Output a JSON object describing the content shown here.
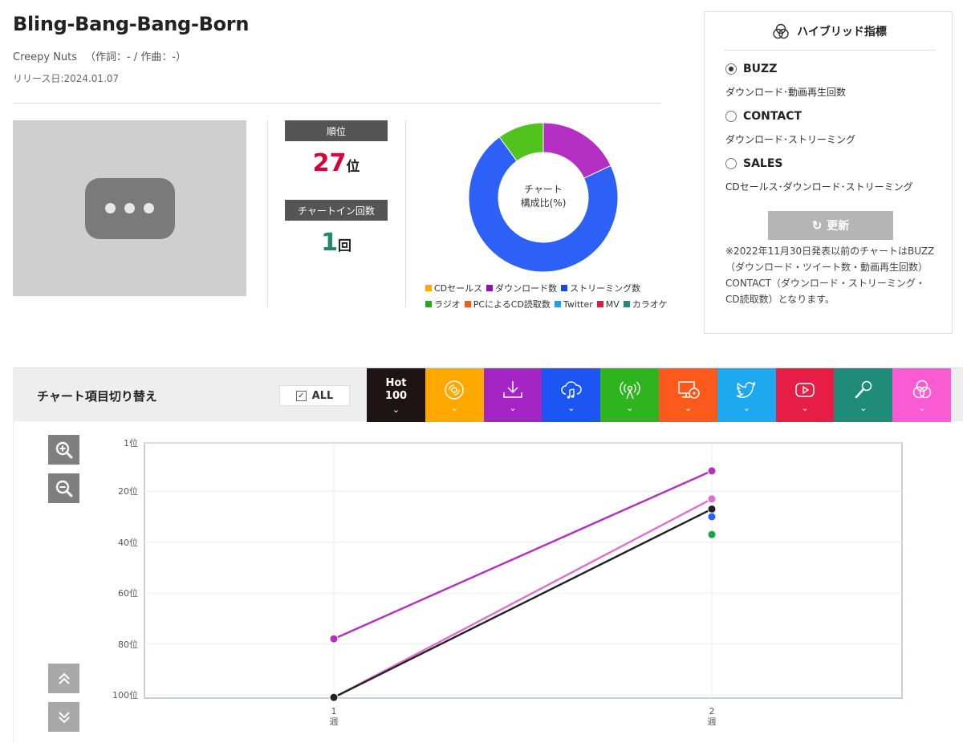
{
  "song": {
    "title": "Bling-Bang-Bang-Born",
    "artist": "Creepy Nuts",
    "credits": "（作詞：- / 作曲：-）",
    "release": "リリース日:2024.01.07"
  },
  "stats": {
    "rank_label": "順位",
    "rank_value": "27",
    "rank_unit": "位",
    "chartin_label": "チャートイン回数",
    "chartin_value": "1",
    "chartin_unit": "回"
  },
  "donut": {
    "center_line1": "チャート",
    "center_line2": "構成比(%)",
    "segments": [
      {
        "name": "ダウンロード数",
        "value": 18,
        "color": "#b52fc3"
      },
      {
        "name": "ストリーミング数",
        "value": 72,
        "color": "#2c60f6"
      },
      {
        "name": "ラジオ",
        "value": 10,
        "color": "#52c21e"
      }
    ],
    "legend": [
      {
        "label": "CDセールス",
        "color": "#ffa800"
      },
      {
        "label": "ダウンロード数",
        "color": "#8e14b0"
      },
      {
        "label": "ストリーミング数",
        "color": "#1448ea"
      },
      {
        "label": "ラジオ",
        "color": "#28a81e"
      },
      {
        "label": "PCによるCD読取数",
        "color": "#fa5a14"
      },
      {
        "label": "Twitter",
        "color": "#1ea0f0"
      },
      {
        "label": "MV",
        "color": "#dc1e3c"
      },
      {
        "label": "カラオケ",
        "color": "#1e8c78"
      }
    ]
  },
  "hybrid": {
    "title": "ハイブリッド指標",
    "options": [
      {
        "label": "BUZZ",
        "desc": "ダウンロード･動画再生回数",
        "selected": true
      },
      {
        "label": "CONTACT",
        "desc": "ダウンロード･ストリーミング",
        "selected": false
      },
      {
        "label": "SALES",
        "desc": "CDセールス･ダウンロード･ストリーミング",
        "selected": false
      }
    ],
    "refresh_label": "更新",
    "note": "※2022年11月30日発表以前のチャートはBUZZ（ダウンロード・ツイート数・動画再生回数）CONTACT（ダウンロード・ストリーミング・CD読取数）となります。"
  },
  "switcher": {
    "title": "チャート項目切り替え",
    "all_label": "ALL",
    "tabs": [
      {
        "name": "hot100",
        "label": "Hot 100",
        "color": "#1f1414",
        "icon": "hot100-text"
      },
      {
        "name": "cd-sales",
        "color": "#ffa800",
        "icon": "disc-icon"
      },
      {
        "name": "download",
        "color": "#a424c4",
        "icon": "download-icon"
      },
      {
        "name": "streaming",
        "color": "#1b55f4",
        "icon": "cloud-music-icon"
      },
      {
        "name": "radio",
        "color": "#2db41e",
        "icon": "radio-icon"
      },
      {
        "name": "pc-cd-read",
        "color": "#fb5a1c",
        "icon": "pc-disc-icon"
      },
      {
        "name": "twitter",
        "color": "#1ea8f0",
        "icon": "twitter-icon"
      },
      {
        "name": "mv",
        "color": "#e61e46",
        "icon": "youtube-icon"
      },
      {
        "name": "karaoke",
        "color": "#1e8c78",
        "icon": "microphone-icon"
      },
      {
        "name": "hybrid",
        "color": "#fa5ad2",
        "icon": "hybrid-icon"
      }
    ]
  },
  "chart_data": {
    "type": "line",
    "x": [
      1,
      2
    ],
    "x_tick_labels": [
      [
        "1",
        "週"
      ],
      [
        "2",
        "週"
      ]
    ],
    "y_tick_labels": [
      "1位",
      "20位",
      "40位",
      "60位",
      "80位",
      "100位"
    ],
    "y_ticks": [
      1,
      20,
      40,
      60,
      80,
      100
    ],
    "ylim": [
      1,
      100
    ],
    "y_inverted": true,
    "series": [
      {
        "color": "#b52fc3",
        "values": [
          78,
          12
        ]
      },
      {
        "color": "#de6fd1",
        "values": [
          101,
          23
        ]
      },
      {
        "color": "#222222",
        "values": [
          101,
          27
        ]
      },
      {
        "color": "#2c60f6",
        "values": [
          null,
          30
        ]
      },
      {
        "color": "#16a34a",
        "values": [
          null,
          37
        ]
      }
    ]
  }
}
